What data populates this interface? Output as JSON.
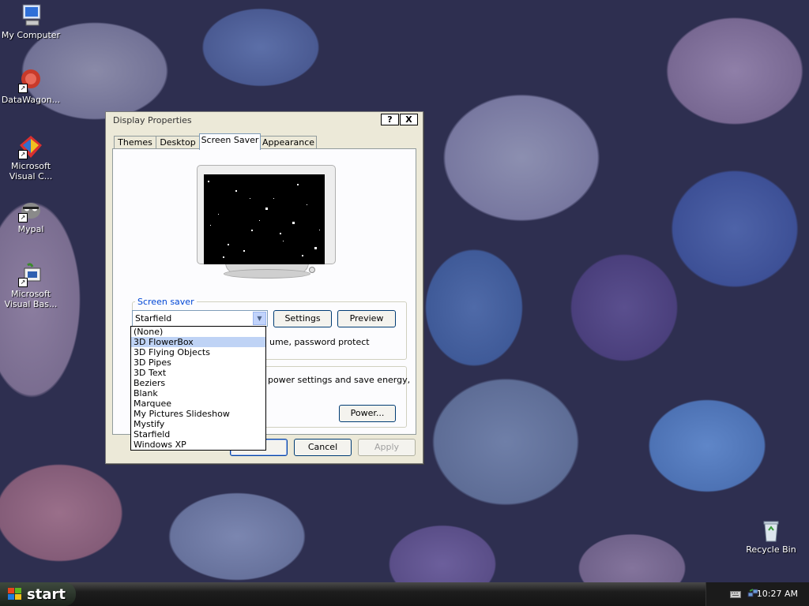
{
  "desktop": {
    "icons": [
      {
        "label": "My Computer",
        "icon": "computer-icon"
      },
      {
        "label": "DataWagon...",
        "icon": "datawagon-icon"
      },
      {
        "label": "Microsoft Visual C...",
        "icon": "visual-c-icon"
      },
      {
        "label": "Mypal",
        "icon": "mypal-icon"
      },
      {
        "label": "Microsoft Visual Bas...",
        "icon": "visual-basic-icon"
      },
      {
        "label": "Recycle Bin",
        "icon": "recycle-bin-icon"
      }
    ]
  },
  "window": {
    "title": "Display Properties",
    "help_glyph": "?",
    "close_glyph": "X",
    "tabs": [
      {
        "label": "Themes"
      },
      {
        "label": "Desktop"
      },
      {
        "label": "Screen Saver",
        "active": true
      },
      {
        "label": "Appearance"
      }
    ]
  },
  "screensaver": {
    "group_label": "Screen saver",
    "selected": "Starfield",
    "settings_label": "Settings",
    "preview_label": "Preview",
    "partial_text": "ume, password protect",
    "options": [
      "(None)",
      "3D FlowerBox",
      "3D Flying Objects",
      "3D Pipes",
      "3D Text",
      "Beziers",
      "Blank",
      "Marquee",
      "My Pictures Slideshow",
      "Mystify",
      "Starfield",
      "Windows XP"
    ],
    "highlighted": "3D FlowerBox"
  },
  "power": {
    "partial_text": "power settings and save energy,",
    "power_label": "Power..."
  },
  "footer": {
    "ok_label": "",
    "cancel_label": "Cancel",
    "apply_label": "Apply"
  },
  "taskbar": {
    "start_label": "start",
    "clock": "10:27 AM"
  }
}
